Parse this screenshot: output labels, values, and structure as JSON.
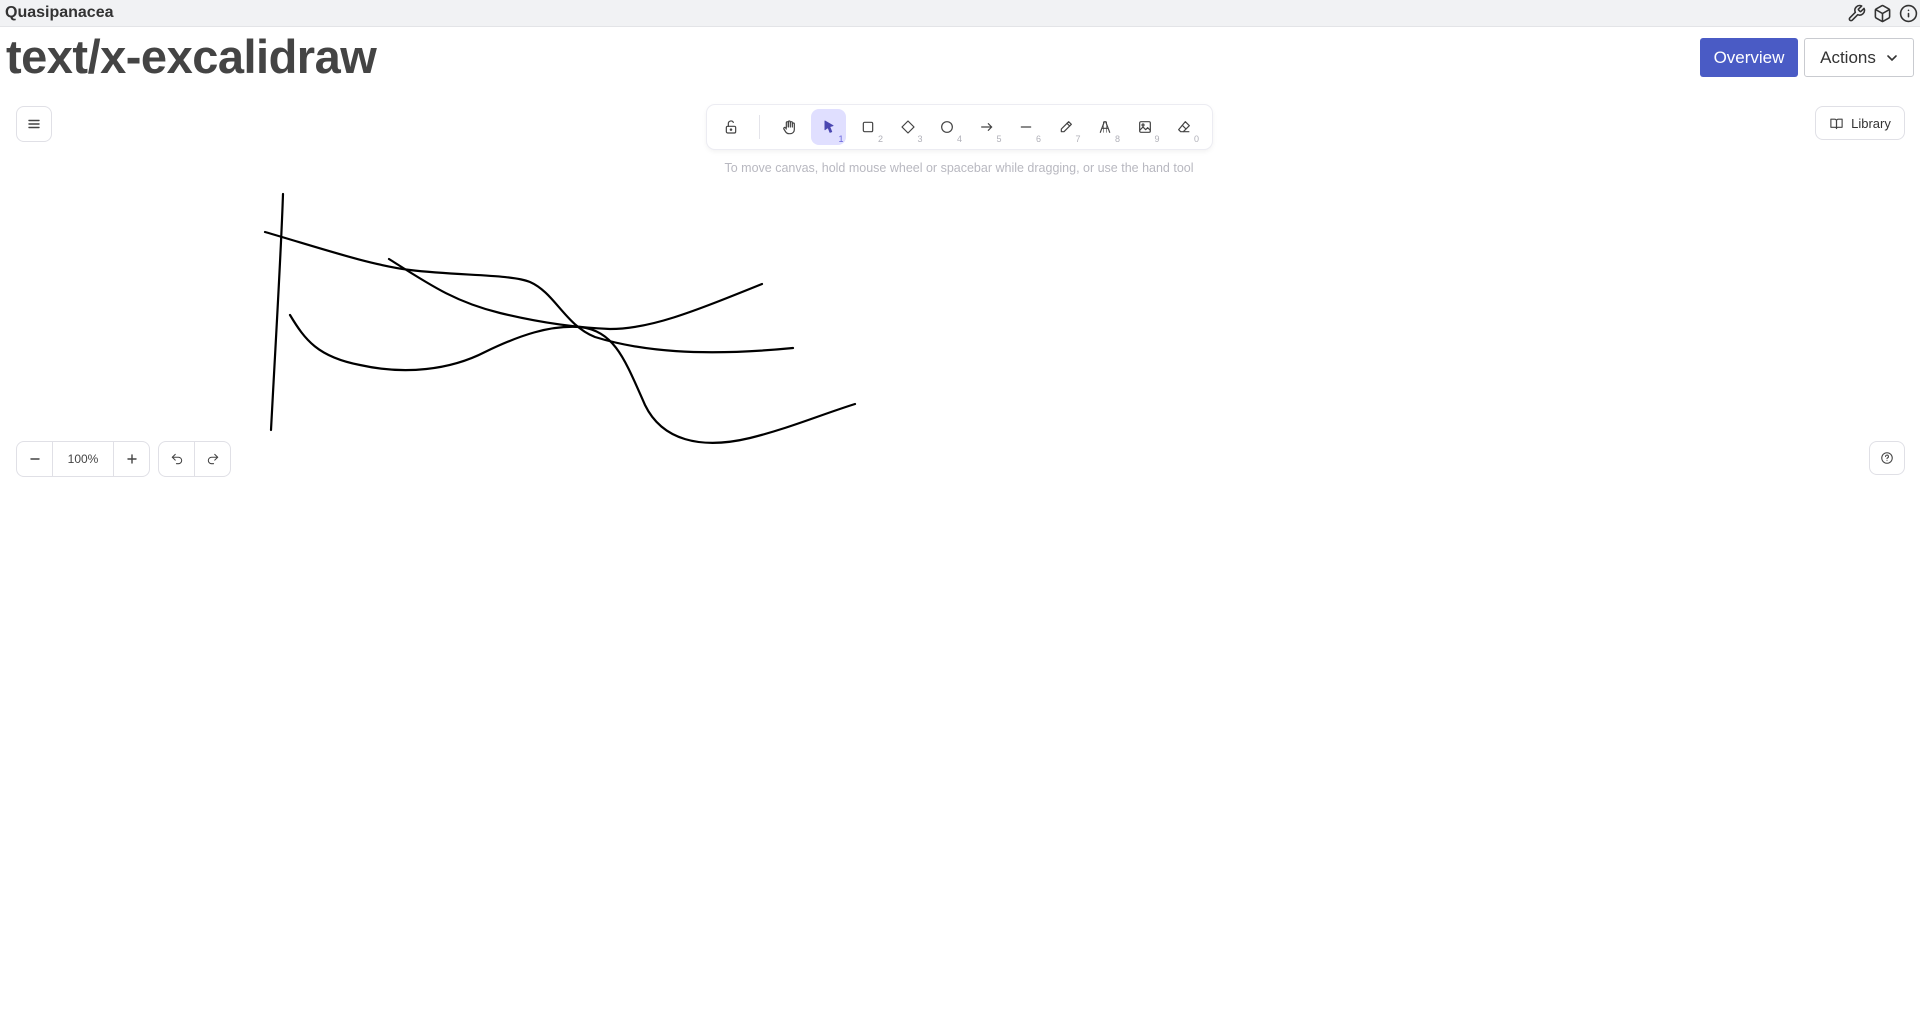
{
  "app": {
    "name": "Quasipanacea"
  },
  "header": {
    "title": "text/x-excalidraw",
    "overview_label": "Overview",
    "actions_label": "Actions"
  },
  "top_icons": [
    "wrench-icon",
    "cube-icon",
    "info-icon"
  ],
  "excalidraw": {
    "menu_icon": "hamburger-icon",
    "tools": [
      {
        "name": "lock",
        "icon": "lock-icon",
        "key": ""
      },
      {
        "name": "hand",
        "icon": "hand-icon",
        "key": ""
      },
      {
        "name": "selection",
        "icon": "pointer-icon",
        "key": "1",
        "active": true
      },
      {
        "name": "rectangle",
        "icon": "square-icon",
        "key": "2"
      },
      {
        "name": "diamond",
        "icon": "diamond-icon",
        "key": "3"
      },
      {
        "name": "ellipse",
        "icon": "circle-icon",
        "key": "4"
      },
      {
        "name": "arrow",
        "icon": "arrow-icon",
        "key": "5"
      },
      {
        "name": "line",
        "icon": "line-icon",
        "key": "6"
      },
      {
        "name": "draw",
        "icon": "pencil-icon",
        "key": "7"
      },
      {
        "name": "text",
        "icon": "text-icon",
        "key": "8"
      },
      {
        "name": "image",
        "icon": "image-icon",
        "key": "9"
      },
      {
        "name": "eraser",
        "icon": "eraser-icon",
        "key": "0"
      }
    ],
    "hint": "To move canvas, hold mouse wheel or spacebar while dragging, or use the hand tool",
    "library_label": "Library",
    "zoom_level": "100%",
    "accent_color": "#6965db"
  },
  "colors": {
    "primary_button": "#4a5bc5",
    "stroke": "#000000"
  }
}
